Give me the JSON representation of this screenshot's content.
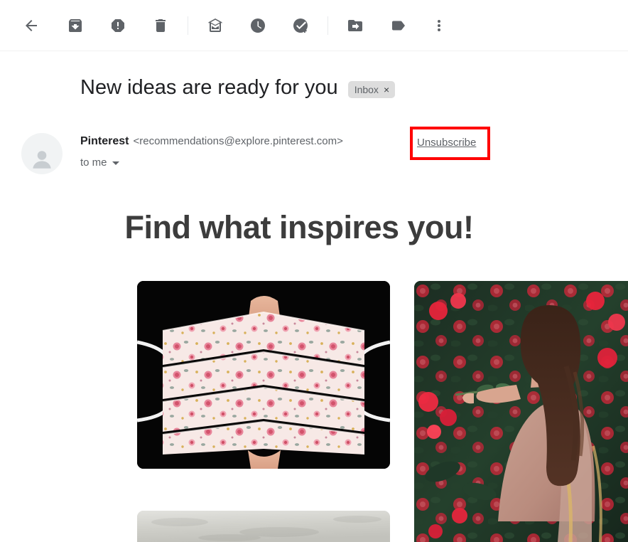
{
  "toolbar": {
    "items": [
      {
        "name": "back-button",
        "icon": "back-arrow-icon",
        "label": "Back to Inbox"
      },
      {
        "name": "archive-button",
        "icon": "archive-icon",
        "label": "Archive"
      },
      {
        "name": "report-spam-button",
        "icon": "report-spam-icon",
        "label": "Report spam"
      },
      {
        "name": "delete-button",
        "icon": "trash-icon",
        "label": "Delete"
      },
      {
        "name": "mark-unread-button",
        "icon": "mark-unread-icon",
        "label": "Mark as unread"
      },
      {
        "name": "snooze-button",
        "icon": "clock-icon",
        "label": "Snooze"
      },
      {
        "name": "add-to-tasks-button",
        "icon": "add-task-icon",
        "label": "Add to Tasks"
      },
      {
        "name": "move-to-button",
        "icon": "move-to-folder-icon",
        "label": "Move to"
      },
      {
        "name": "labels-button",
        "icon": "label-tag-icon",
        "label": "Labels"
      },
      {
        "name": "more-options-button",
        "icon": "more-vertical-icon",
        "label": "More"
      }
    ]
  },
  "email": {
    "subject": "New ideas are ready for you",
    "label_chip": {
      "text": "Inbox",
      "close": "×"
    },
    "sender_name": "Pinterest",
    "sender_email": "<recommendations@explore.pinterest.com>",
    "unsubscribe_label": "Unsubscribe",
    "recipient": "to me",
    "headline": "Find what inspires you!"
  },
  "highlight": {
    "color": "#ff0000",
    "target": "unsubscribe-link"
  },
  "images": [
    {
      "name": "pin-image-floral-mask",
      "alt": "Floral print pleated face mask on black background"
    },
    {
      "name": "pin-image-woman-flowers",
      "alt": "Woman in pink saree beside red bougainvillea flowers"
    },
    {
      "name": "pin-image-gray-texture",
      "alt": "Light gray textured surface"
    }
  ],
  "colors": {
    "icon": "#5f6368",
    "text_primary": "#202124",
    "text_secondary": "#5f6368",
    "chip_bg": "#dddddd",
    "headline": "#3c3c3c"
  }
}
